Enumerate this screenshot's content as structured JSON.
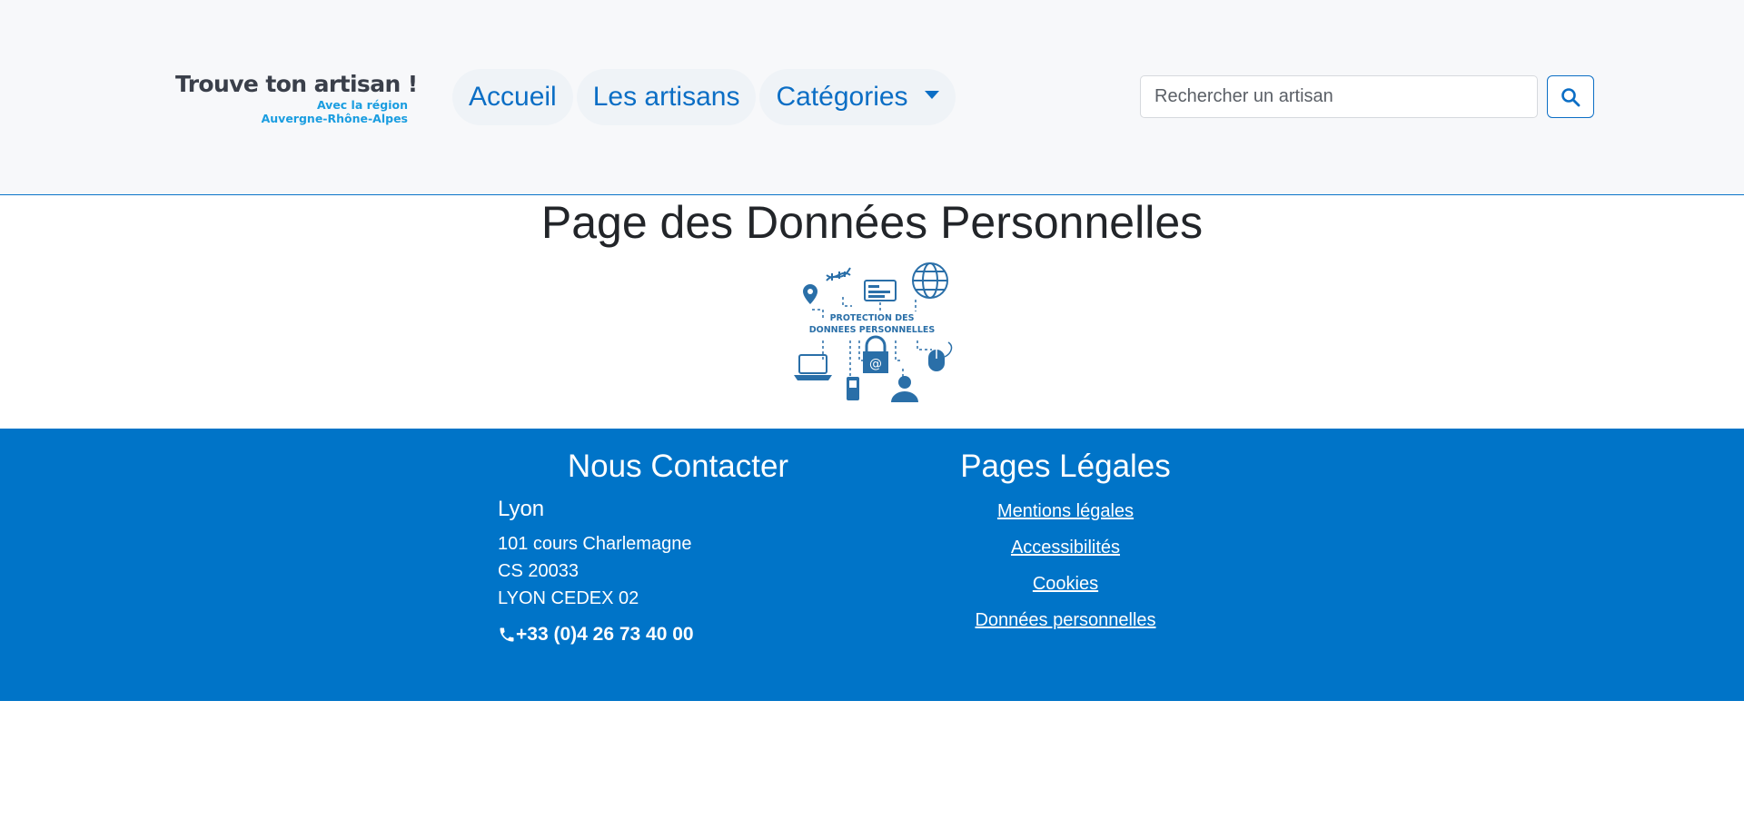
{
  "logo": {
    "title": "Trouve ton artisan !",
    "subtitle_line1": "Avec la région",
    "subtitle_line2": "Auvergne-Rhône-Alpes"
  },
  "nav": {
    "items": [
      {
        "label": "Accueil"
      },
      {
        "label": "Les artisans"
      },
      {
        "label": "Catégories"
      }
    ]
  },
  "search": {
    "placeholder": "Rechercher un artisan",
    "button_icon": "search-icon"
  },
  "main": {
    "title": "Page des Données Personnelles",
    "image": {
      "line1": "PROTECTION DES",
      "line2": "DONNEES PERSONNELLES",
      "icons": [
        "location-icon",
        "dna-icon",
        "id-card-icon",
        "globe-icon",
        "laptop-icon",
        "phone-icon",
        "lock-icon",
        "user-icon",
        "mouse-icon"
      ]
    }
  },
  "footer": {
    "contact": {
      "heading": "Nous Contacter",
      "city": "Lyon",
      "address": [
        "101 cours Charlemagne",
        "CS 20033",
        "LYON CEDEX 02"
      ],
      "phone": "+33 (0)4 26 73 40 00"
    },
    "legal": {
      "heading": "Pages Légales",
      "links": [
        "Mentions légales",
        "Accessibilités",
        "Cookies",
        "Données personnelles"
      ]
    }
  },
  "colors": {
    "brand_blue": "#0074c8",
    "link_blue": "#0b6ec5",
    "logo_accent": "#1a9de0",
    "header_bg": "#f7f8fa"
  }
}
